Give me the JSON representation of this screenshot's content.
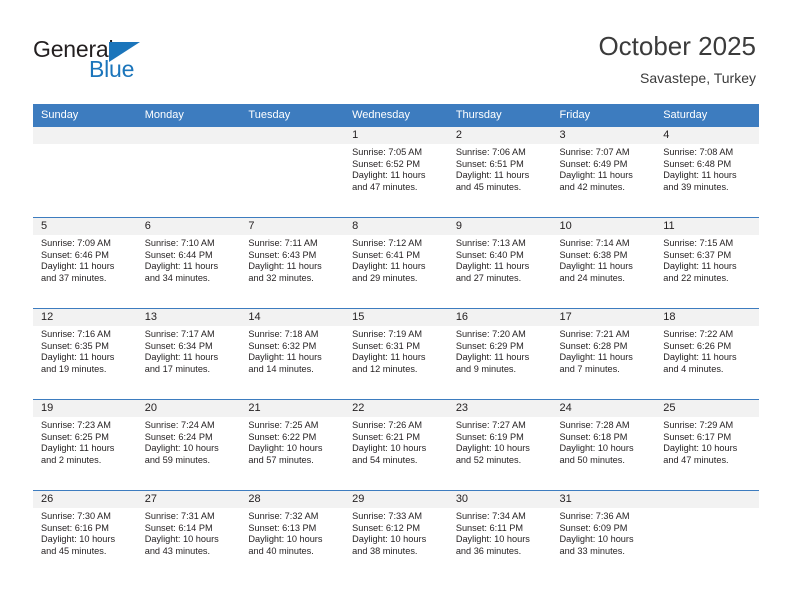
{
  "brand": {
    "name_part1": "General",
    "name_part2": "Blue",
    "accent_color": "#1b75bb"
  },
  "header": {
    "title": "October 2025",
    "location": "Savastepe, Turkey"
  },
  "theme": {
    "header_row_bg": "#3d7cbf",
    "daynum_band_bg": "#f2f2f2",
    "text_color": "#231f20"
  },
  "weekdays": [
    "Sunday",
    "Monday",
    "Tuesday",
    "Wednesday",
    "Thursday",
    "Friday",
    "Saturday"
  ],
  "weeks": [
    [
      {
        "day": "",
        "empty": true,
        "sunrise": "",
        "sunset": "",
        "daylight_line1": "",
        "daylight_line2": ""
      },
      {
        "day": "",
        "empty": true,
        "sunrise": "",
        "sunset": "",
        "daylight_line1": "",
        "daylight_line2": ""
      },
      {
        "day": "",
        "empty": true,
        "sunrise": "",
        "sunset": "",
        "daylight_line1": "",
        "daylight_line2": ""
      },
      {
        "day": "1",
        "empty": false,
        "sunrise": "Sunrise: 7:05 AM",
        "sunset": "Sunset: 6:52 PM",
        "daylight_line1": "Daylight: 11 hours",
        "daylight_line2": "and 47 minutes."
      },
      {
        "day": "2",
        "empty": false,
        "sunrise": "Sunrise: 7:06 AM",
        "sunset": "Sunset: 6:51 PM",
        "daylight_line1": "Daylight: 11 hours",
        "daylight_line2": "and 45 minutes."
      },
      {
        "day": "3",
        "empty": false,
        "sunrise": "Sunrise: 7:07 AM",
        "sunset": "Sunset: 6:49 PM",
        "daylight_line1": "Daylight: 11 hours",
        "daylight_line2": "and 42 minutes."
      },
      {
        "day": "4",
        "empty": false,
        "sunrise": "Sunrise: 7:08 AM",
        "sunset": "Sunset: 6:48 PM",
        "daylight_line1": "Daylight: 11 hours",
        "daylight_line2": "and 39 minutes."
      }
    ],
    [
      {
        "day": "5",
        "empty": false,
        "sunrise": "Sunrise: 7:09 AM",
        "sunset": "Sunset: 6:46 PM",
        "daylight_line1": "Daylight: 11 hours",
        "daylight_line2": "and 37 minutes."
      },
      {
        "day": "6",
        "empty": false,
        "sunrise": "Sunrise: 7:10 AM",
        "sunset": "Sunset: 6:44 PM",
        "daylight_line1": "Daylight: 11 hours",
        "daylight_line2": "and 34 minutes."
      },
      {
        "day": "7",
        "empty": false,
        "sunrise": "Sunrise: 7:11 AM",
        "sunset": "Sunset: 6:43 PM",
        "daylight_line1": "Daylight: 11 hours",
        "daylight_line2": "and 32 minutes."
      },
      {
        "day": "8",
        "empty": false,
        "sunrise": "Sunrise: 7:12 AM",
        "sunset": "Sunset: 6:41 PM",
        "daylight_line1": "Daylight: 11 hours",
        "daylight_line2": "and 29 minutes."
      },
      {
        "day": "9",
        "empty": false,
        "sunrise": "Sunrise: 7:13 AM",
        "sunset": "Sunset: 6:40 PM",
        "daylight_line1": "Daylight: 11 hours",
        "daylight_line2": "and 27 minutes."
      },
      {
        "day": "10",
        "empty": false,
        "sunrise": "Sunrise: 7:14 AM",
        "sunset": "Sunset: 6:38 PM",
        "daylight_line1": "Daylight: 11 hours",
        "daylight_line2": "and 24 minutes."
      },
      {
        "day": "11",
        "empty": false,
        "sunrise": "Sunrise: 7:15 AM",
        "sunset": "Sunset: 6:37 PM",
        "daylight_line1": "Daylight: 11 hours",
        "daylight_line2": "and 22 minutes."
      }
    ],
    [
      {
        "day": "12",
        "empty": false,
        "sunrise": "Sunrise: 7:16 AM",
        "sunset": "Sunset: 6:35 PM",
        "daylight_line1": "Daylight: 11 hours",
        "daylight_line2": "and 19 minutes."
      },
      {
        "day": "13",
        "empty": false,
        "sunrise": "Sunrise: 7:17 AM",
        "sunset": "Sunset: 6:34 PM",
        "daylight_line1": "Daylight: 11 hours",
        "daylight_line2": "and 17 minutes."
      },
      {
        "day": "14",
        "empty": false,
        "sunrise": "Sunrise: 7:18 AM",
        "sunset": "Sunset: 6:32 PM",
        "daylight_line1": "Daylight: 11 hours",
        "daylight_line2": "and 14 minutes."
      },
      {
        "day": "15",
        "empty": false,
        "sunrise": "Sunrise: 7:19 AM",
        "sunset": "Sunset: 6:31 PM",
        "daylight_line1": "Daylight: 11 hours",
        "daylight_line2": "and 12 minutes."
      },
      {
        "day": "16",
        "empty": false,
        "sunrise": "Sunrise: 7:20 AM",
        "sunset": "Sunset: 6:29 PM",
        "daylight_line1": "Daylight: 11 hours",
        "daylight_line2": "and 9 minutes."
      },
      {
        "day": "17",
        "empty": false,
        "sunrise": "Sunrise: 7:21 AM",
        "sunset": "Sunset: 6:28 PM",
        "daylight_line1": "Daylight: 11 hours",
        "daylight_line2": "and 7 minutes."
      },
      {
        "day": "18",
        "empty": false,
        "sunrise": "Sunrise: 7:22 AM",
        "sunset": "Sunset: 6:26 PM",
        "daylight_line1": "Daylight: 11 hours",
        "daylight_line2": "and 4 minutes."
      }
    ],
    [
      {
        "day": "19",
        "empty": false,
        "sunrise": "Sunrise: 7:23 AM",
        "sunset": "Sunset: 6:25 PM",
        "daylight_line1": "Daylight: 11 hours",
        "daylight_line2": "and 2 minutes."
      },
      {
        "day": "20",
        "empty": false,
        "sunrise": "Sunrise: 7:24 AM",
        "sunset": "Sunset: 6:24 PM",
        "daylight_line1": "Daylight: 10 hours",
        "daylight_line2": "and 59 minutes."
      },
      {
        "day": "21",
        "empty": false,
        "sunrise": "Sunrise: 7:25 AM",
        "sunset": "Sunset: 6:22 PM",
        "daylight_line1": "Daylight: 10 hours",
        "daylight_line2": "and 57 minutes."
      },
      {
        "day": "22",
        "empty": false,
        "sunrise": "Sunrise: 7:26 AM",
        "sunset": "Sunset: 6:21 PM",
        "daylight_line1": "Daylight: 10 hours",
        "daylight_line2": "and 54 minutes."
      },
      {
        "day": "23",
        "empty": false,
        "sunrise": "Sunrise: 7:27 AM",
        "sunset": "Sunset: 6:19 PM",
        "daylight_line1": "Daylight: 10 hours",
        "daylight_line2": "and 52 minutes."
      },
      {
        "day": "24",
        "empty": false,
        "sunrise": "Sunrise: 7:28 AM",
        "sunset": "Sunset: 6:18 PM",
        "daylight_line1": "Daylight: 10 hours",
        "daylight_line2": "and 50 minutes."
      },
      {
        "day": "25",
        "empty": false,
        "sunrise": "Sunrise: 7:29 AM",
        "sunset": "Sunset: 6:17 PM",
        "daylight_line1": "Daylight: 10 hours",
        "daylight_line2": "and 47 minutes."
      }
    ],
    [
      {
        "day": "26",
        "empty": false,
        "sunrise": "Sunrise: 7:30 AM",
        "sunset": "Sunset: 6:16 PM",
        "daylight_line1": "Daylight: 10 hours",
        "daylight_line2": "and 45 minutes."
      },
      {
        "day": "27",
        "empty": false,
        "sunrise": "Sunrise: 7:31 AM",
        "sunset": "Sunset: 6:14 PM",
        "daylight_line1": "Daylight: 10 hours",
        "daylight_line2": "and 43 minutes."
      },
      {
        "day": "28",
        "empty": false,
        "sunrise": "Sunrise: 7:32 AM",
        "sunset": "Sunset: 6:13 PM",
        "daylight_line1": "Daylight: 10 hours",
        "daylight_line2": "and 40 minutes."
      },
      {
        "day": "29",
        "empty": false,
        "sunrise": "Sunrise: 7:33 AM",
        "sunset": "Sunset: 6:12 PM",
        "daylight_line1": "Daylight: 10 hours",
        "daylight_line2": "and 38 minutes."
      },
      {
        "day": "30",
        "empty": false,
        "sunrise": "Sunrise: 7:34 AM",
        "sunset": "Sunset: 6:11 PM",
        "daylight_line1": "Daylight: 10 hours",
        "daylight_line2": "and 36 minutes."
      },
      {
        "day": "31",
        "empty": false,
        "sunrise": "Sunrise: 7:36 AM",
        "sunset": "Sunset: 6:09 PM",
        "daylight_line1": "Daylight: 10 hours",
        "daylight_line2": "and 33 minutes."
      },
      {
        "day": "",
        "empty": true,
        "sunrise": "",
        "sunset": "",
        "daylight_line1": "",
        "daylight_line2": ""
      }
    ]
  ]
}
